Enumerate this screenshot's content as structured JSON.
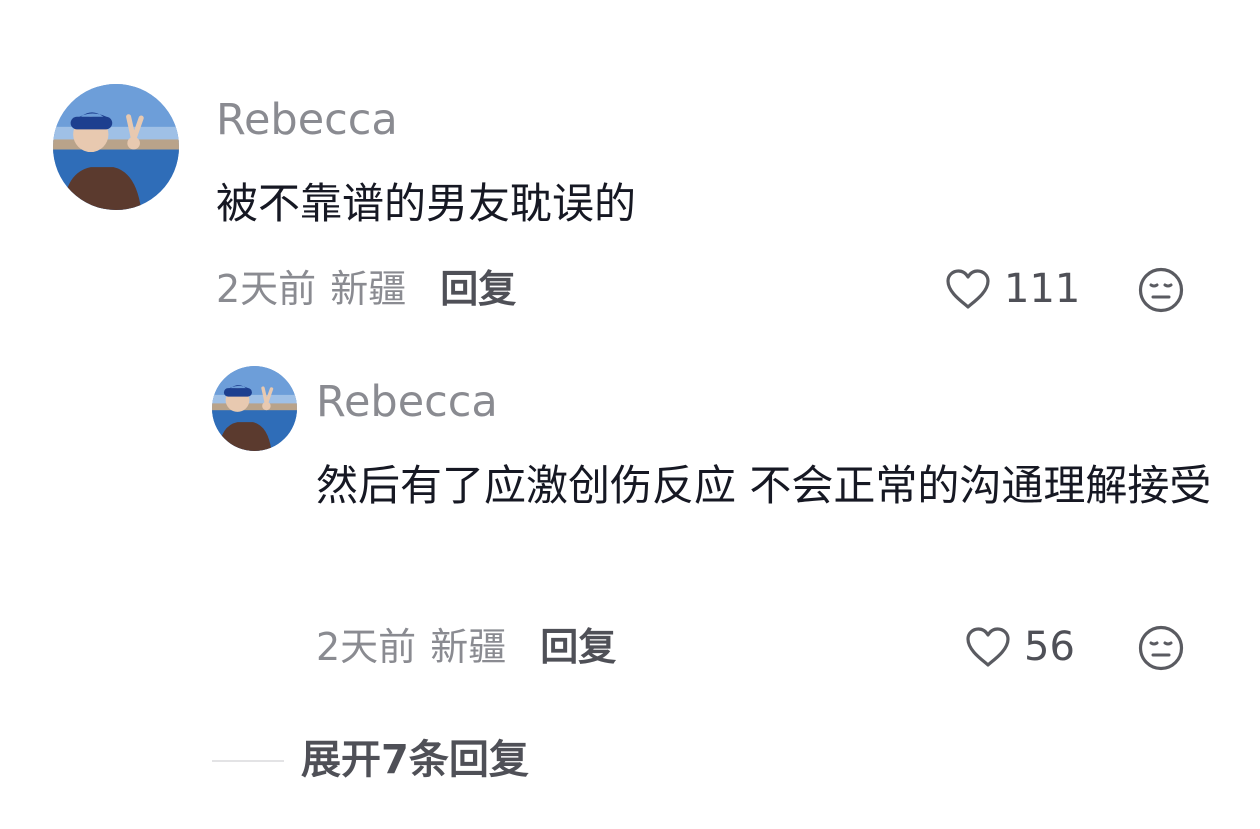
{
  "comment": {
    "username": "Rebecca",
    "text": "被不靠谱的男友耽误的",
    "time": "2天前",
    "location": "新疆",
    "reply_label": "回复",
    "likes": "111"
  },
  "reply": {
    "username": "Rebecca",
    "text": "然后有了应激创伤反应 不会正常的沟通理解接受",
    "time": "2天前",
    "location": "新疆",
    "reply_label": "回复",
    "likes": "56"
  },
  "expand_replies_label": "展开7条回复",
  "icons": {
    "like": "heart-outline-icon",
    "dislike": "meh-face-icon"
  },
  "colors": {
    "primary_text": "#161823",
    "secondary_text": "#8a8b91",
    "action_text": "#4f5057"
  }
}
